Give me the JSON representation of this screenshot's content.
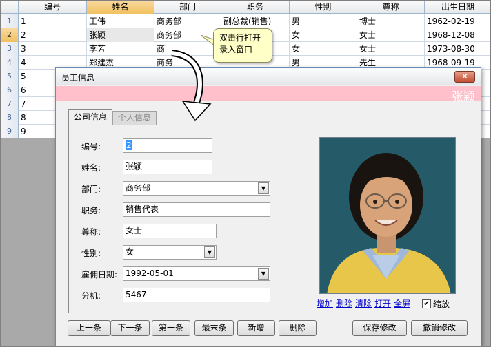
{
  "grid": {
    "columns": [
      "编号",
      "姓名",
      "部门",
      "职务",
      "性别",
      "尊称",
      "出生日期"
    ],
    "rows": [
      {
        "n": "1",
        "c": [
          "1",
          "王伟",
          "商务部",
          "副总裁(销售)",
          "男",
          "博士",
          "1962-02-19"
        ]
      },
      {
        "n": "2",
        "c": [
          "2",
          "张颖",
          "商务部",
          "",
          "女",
          "女士",
          "1968-12-08"
        ]
      },
      {
        "n": "3",
        "c": [
          "3",
          "李芳",
          "商",
          "",
          "女",
          "女士",
          "1973-08-30"
        ]
      },
      {
        "n": "4",
        "c": [
          "4",
          "郑建杰",
          "商务",
          "",
          "男",
          "先生",
          "1968-09-19"
        ]
      },
      {
        "n": "5",
        "c": [
          "5",
          "",
          "",
          "",
          "",
          "",
          ""
        ]
      },
      {
        "n": "6",
        "c": [
          "6",
          "",
          "",
          "",
          "",
          "",
          ""
        ]
      },
      {
        "n": "7",
        "c": [
          "7",
          "",
          "",
          "",
          "",
          "",
          ""
        ]
      },
      {
        "n": "8",
        "c": [
          "8",
          "",
          "",
          "",
          "",
          "",
          ""
        ]
      },
      {
        "n": "9",
        "c": [
          "9",
          "",
          "",
          "",
          "",
          "",
          ""
        ]
      }
    ]
  },
  "callout": "双击行打开录入窗口",
  "dialog": {
    "title": "员工信息",
    "close": "✕",
    "banner_name": "张颖",
    "tabs": [
      "公司信息",
      "个人信息"
    ],
    "fields": {
      "id_label": "编号:",
      "id_value": "2",
      "name_label": "姓名:",
      "name_value": "张颖",
      "dept_label": "部门:",
      "dept_value": "商务部",
      "title_label": "职务:",
      "title_value": "销售代表",
      "courtesy_label": "尊称:",
      "courtesy_value": "女士",
      "gender_label": "性别:",
      "gender_value": "女",
      "hire_label": "雇佣日期:",
      "hire_value": "1992-05-01",
      "ext_label": "分机:",
      "ext_value": "5467"
    },
    "photo_links": [
      "增加",
      "删除",
      "清除",
      "打开",
      "全屏"
    ],
    "zoom_label": "缩放",
    "zoom_checked": true,
    "buttons": {
      "prev": "上一条",
      "next": "下一条",
      "first": "第一条",
      "last": "最末条",
      "add": "新增",
      "delete": "删除",
      "save": "保存修改",
      "cancel": "撤销修改"
    }
  },
  "colors": {
    "banner": "#ffc0cb",
    "header_active": "#f1c15f",
    "link": "#0000cc"
  }
}
